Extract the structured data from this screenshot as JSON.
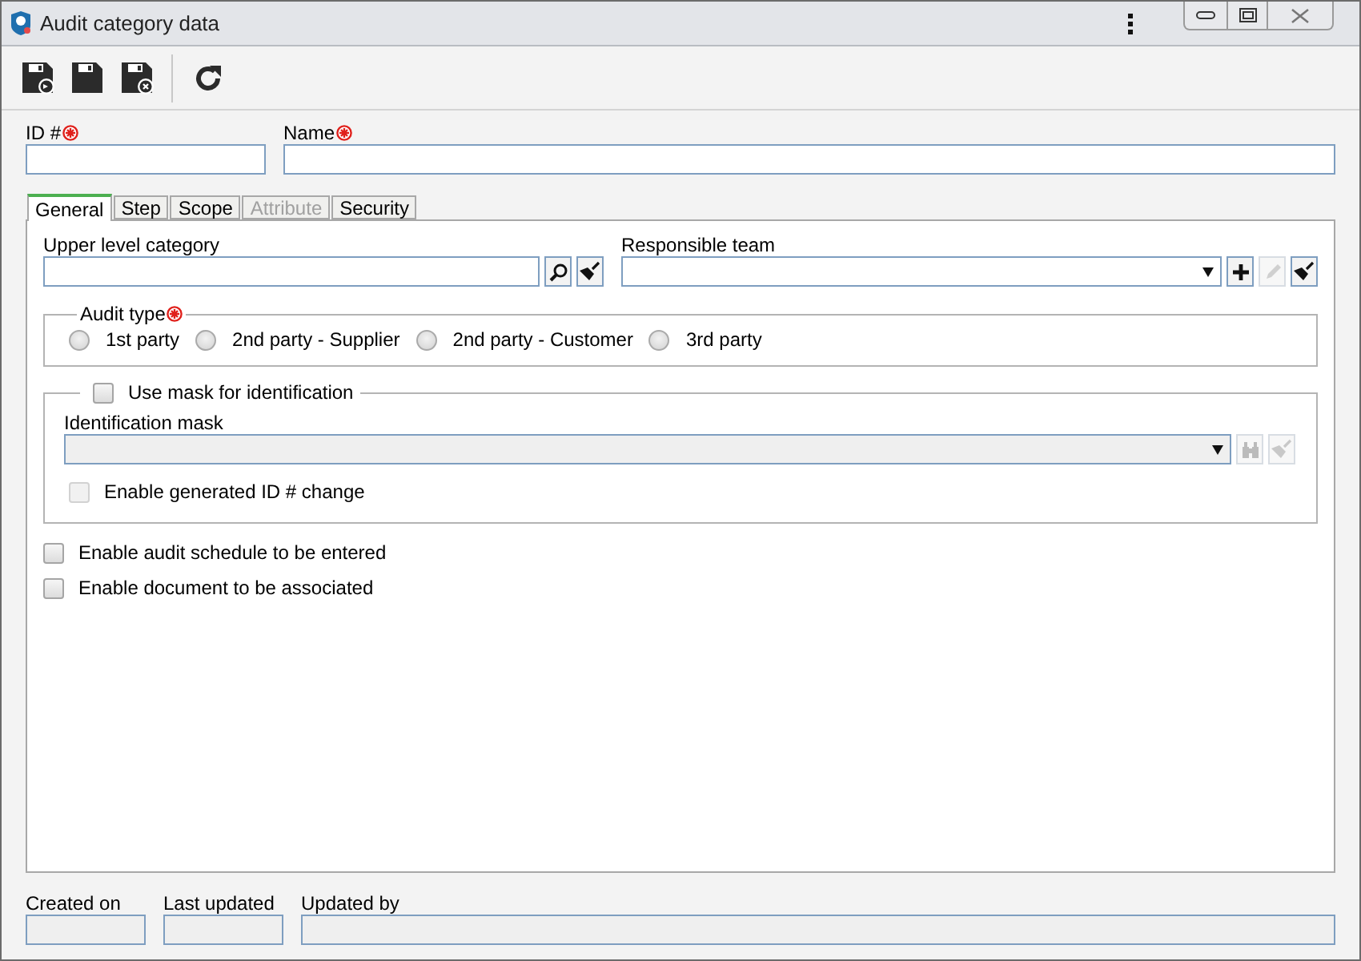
{
  "window": {
    "title": "Audit category data"
  },
  "fields": [
    {
      "label": "ID #",
      "required": true
    },
    {
      "label": "Name",
      "required": true
    }
  ],
  "tabs": [
    {
      "label": "General",
      "selected": true,
      "disabled": false
    },
    {
      "label": "Step",
      "selected": false,
      "disabled": false
    },
    {
      "label": "Scope",
      "selected": false,
      "disabled": false
    },
    {
      "label": "Attribute",
      "selected": false,
      "disabled": true
    },
    {
      "label": "Security",
      "selected": false,
      "disabled": false
    }
  ],
  "upper_level_category": {
    "label": "Upper level category"
  },
  "responsible_team": {
    "label": "Responsible team"
  },
  "audit_type": {
    "label": "Audit type",
    "required": true,
    "options": [
      {
        "label": "1st party",
        "selected": false
      },
      {
        "label": "2nd party - Supplier",
        "selected": false
      },
      {
        "label": "2nd party - Customer",
        "selected": false
      },
      {
        "label": "3rd party",
        "selected": false
      }
    ]
  },
  "mask": {
    "label": "Use mask for identification",
    "checked": false,
    "field": {
      "label": "Identification mask",
      "disabled": true
    },
    "option": {
      "label": "Enable generated ID # change",
      "checked": false,
      "disabled": true
    }
  },
  "options": [
    {
      "label": "Enable audit schedule to be entered",
      "checked": false
    },
    {
      "label": "Enable document to be associated",
      "checked": false
    }
  ],
  "footer": [
    {
      "label": "Created on"
    },
    {
      "label": "Last updated"
    },
    {
      "label": "Updated by"
    }
  ]
}
